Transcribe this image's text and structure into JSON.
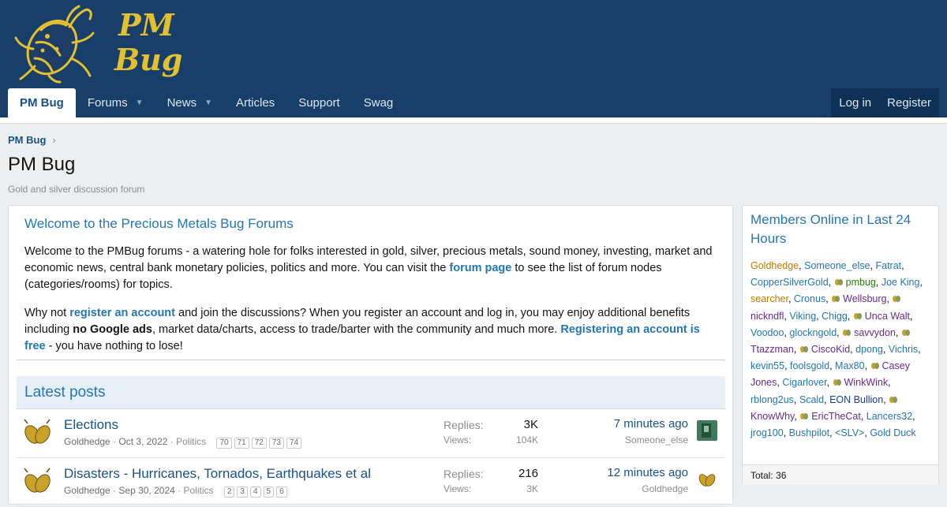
{
  "brand": {
    "line1": "PM",
    "line2": "Bug"
  },
  "nav": {
    "tabs": [
      {
        "label": "PM Bug",
        "active": true,
        "dropdown": false
      },
      {
        "label": "Forums",
        "active": false,
        "dropdown": true
      },
      {
        "label": "News",
        "active": false,
        "dropdown": true
      },
      {
        "label": "Articles",
        "active": false,
        "dropdown": false
      },
      {
        "label": "Support",
        "active": false,
        "dropdown": false
      },
      {
        "label": "Swag",
        "active": false,
        "dropdown": false
      }
    ],
    "login": "Log in",
    "register": "Register"
  },
  "breadcrumb": "PM Bug",
  "page": {
    "title": "PM Bug",
    "description": "Gold and silver discussion forum"
  },
  "welcome": {
    "title": "Welcome to the Precious Metals Bug Forums",
    "p1_a": "Welcome to the PMBug forums - a watering hole for folks interested in gold, silver, precious metals, sound money, investing, market and economic news, central bank monetary policies, politics and more. You can visit the ",
    "p1_link": "forum page",
    "p1_b": " to see the list of forum nodes (categories/rooms) for topics.",
    "p2_a": "Why not ",
    "p2_link1": "register an account",
    "p2_b": " and join the discussions? When you register an account and log in, you may enjoy additional benefits including ",
    "p2_bold": "no Google ads",
    "p2_c": ", market data/charts, access to trade/barter with the community and much more. ",
    "p2_link2": "Registering an account is free",
    "p2_d": " - you have nothing to lose!"
  },
  "latest": {
    "title": "Latest posts",
    "replies_label": "Replies:",
    "views_label": "Views:",
    "threads": [
      {
        "title": "Elections",
        "author": "Goldhedge",
        "date": "Oct 3, 2022",
        "forum": "Politics",
        "pages": [
          "70",
          "71",
          "72",
          "73",
          "74"
        ],
        "replies": "3K",
        "views": "104K",
        "last_time": "7 minutes ago",
        "last_user": "Someone_else"
      },
      {
        "title": "Disasters - Hurricanes, Tornados, Earthquakes et al",
        "author": "Goldhedge",
        "date": "Sep 30, 2024",
        "forum": "Politics",
        "pages": [
          "2",
          "3",
          "4",
          "5",
          "6"
        ],
        "replies": "216",
        "views": "3K",
        "last_time": "12 minutes ago",
        "last_user": "Goldhedge"
      }
    ]
  },
  "online": {
    "title": "Members Online in Last 24 Hours",
    "members": [
      {
        "name": "Goldhedge",
        "color": "gold",
        "icon": false
      },
      {
        "name": "Someone_else",
        "color": "blue",
        "icon": false
      },
      {
        "name": "Fatrat",
        "color": "blue",
        "icon": false
      },
      {
        "name": "CopperSilverGold",
        "color": "blue",
        "icon": false
      },
      {
        "name": "pmbug",
        "color": "green",
        "icon": true
      },
      {
        "name": "Joe King",
        "color": "blue",
        "icon": false
      },
      {
        "name": "searcher",
        "color": "gold",
        "icon": false
      },
      {
        "name": "Cronus",
        "color": "blue",
        "icon": false
      },
      {
        "name": "Wellsburg",
        "color": "purple",
        "icon": true
      },
      {
        "name": "nickndfl",
        "color": "purple",
        "icon": true
      },
      {
        "name": "Viking",
        "color": "blue",
        "icon": false
      },
      {
        "name": "Chigg",
        "color": "blue",
        "icon": false
      },
      {
        "name": "Unca Walt",
        "color": "purple",
        "icon": true
      },
      {
        "name": "Voodoo",
        "color": "blue",
        "icon": false
      },
      {
        "name": "glockngold",
        "color": "blue",
        "icon": false
      },
      {
        "name": "savvydon",
        "color": "purple",
        "icon": true
      },
      {
        "name": "Ttazzman",
        "color": "purple",
        "icon": true
      },
      {
        "name": "CiscoKid",
        "color": "purple",
        "icon": true
      },
      {
        "name": "dpong",
        "color": "blue",
        "icon": false
      },
      {
        "name": "Vichris",
        "color": "blue",
        "icon": false
      },
      {
        "name": "kevin55",
        "color": "blue",
        "icon": false
      },
      {
        "name": "foolsgold",
        "color": "blue",
        "icon": false
      },
      {
        "name": "Max80",
        "color": "blue",
        "icon": false
      },
      {
        "name": "Casey Jones",
        "color": "purple",
        "icon": true
      },
      {
        "name": "Cigarlover",
        "color": "blue",
        "icon": false
      },
      {
        "name": "WinkWink",
        "color": "purple",
        "icon": true
      },
      {
        "name": "rblong2us",
        "color": "blue",
        "icon": false
      },
      {
        "name": "Scald",
        "color": "blue",
        "icon": false
      },
      {
        "name": "EON Bullion",
        "color": "darkblue",
        "icon": false
      },
      {
        "name": "KnowWhy",
        "color": "purple",
        "icon": true
      },
      {
        "name": "EricTheCat",
        "color": "purple",
        "icon": true
      },
      {
        "name": "Lancers32",
        "color": "blue",
        "icon": false
      },
      {
        "name": "jrog100",
        "color": "blue",
        "icon": false
      },
      {
        "name": "Bushpilot",
        "color": "blue",
        "icon": false
      },
      {
        "name": "<SLV>",
        "color": "blue",
        "icon": false
      },
      {
        "name": "Gold Duck",
        "color": "blue",
        "icon": false
      }
    ],
    "total": "Total: 36"
  },
  "colors": {
    "header": "#183f6a",
    "link": "#2577b1",
    "accent_gold": "#e3c030"
  }
}
